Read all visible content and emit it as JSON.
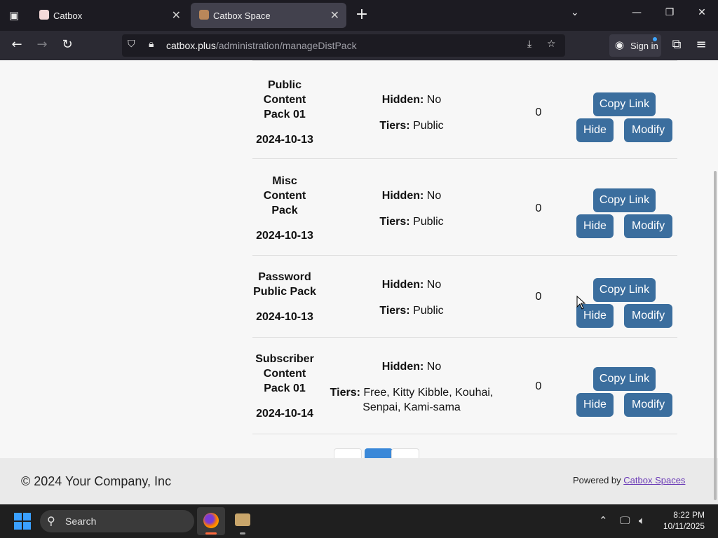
{
  "browser": {
    "tabs": [
      {
        "title": "Catbox",
        "close": "✕"
      },
      {
        "title": "Catbox Space",
        "close": "✕"
      }
    ],
    "new_tab": "+",
    "url_host": "catbox.plus",
    "url_path": "/administration/manageDistPack",
    "sign_in": "Sign in"
  },
  "packs": [
    {
      "name": "Public Content Pack 01",
      "date": "2024-10-13",
      "hidden_label": "Hidden:",
      "hidden": "No",
      "tiers_label": "Tiers:",
      "tiers": "Public",
      "count": "0",
      "copy": "Copy Link",
      "hide": "Hide",
      "modify": "Modify"
    },
    {
      "name": "Misc Content Pack",
      "date": "2024-10-13",
      "hidden_label": "Hidden:",
      "hidden": "No",
      "tiers_label": "Tiers:",
      "tiers": "Public",
      "count": "0",
      "copy": "Copy Link",
      "hide": "Hide",
      "modify": "Modify"
    },
    {
      "name": "Password Public Pack",
      "date": "2024-10-13",
      "hidden_label": "Hidden:",
      "hidden": "No",
      "tiers_label": "Tiers:",
      "tiers": "Public",
      "count": "0",
      "copy": "Copy Link",
      "hide": "Hide",
      "modify": "Modify"
    },
    {
      "name": "Subscriber Content Pack 01",
      "date": "2024-10-14",
      "hidden_label": "Hidden:",
      "hidden": "No",
      "tiers_label": "Tiers:",
      "tiers": "Free, Kitty Kibble, Kouhai, Senpai, Kami-sama",
      "count": "0",
      "copy": "Copy Link",
      "hide": "Hide",
      "modify": "Modify"
    }
  ],
  "footer": {
    "copyright": "© 2024 Your Company, Inc",
    "powered_prefix": "Powered by ",
    "powered_link": "Catbox Spaces"
  },
  "taskbar": {
    "search_placeholder": "Search",
    "time": "8:22 PM",
    "date": "10/11/2025"
  }
}
